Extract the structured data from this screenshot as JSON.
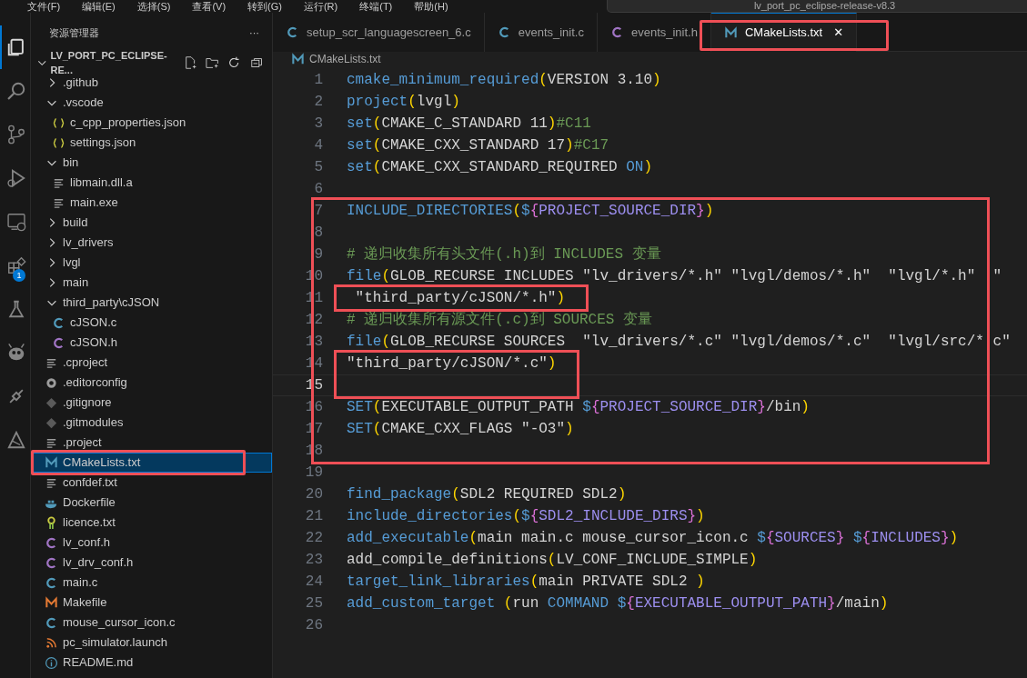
{
  "title_bar": {
    "menu": [
      "文件(F)",
      "编辑(E)",
      "选择(S)",
      "查看(V)",
      "转到(G)",
      "运行(R)",
      "终端(T)",
      "帮助(H)"
    ],
    "search": "lv_port_pc_eclipse-release-v8.3"
  },
  "activity_bar": [
    {
      "kind": "explorer",
      "selected": true
    },
    {
      "kind": "search",
      "selected": false
    },
    {
      "kind": "source-control",
      "selected": false
    },
    {
      "kind": "run",
      "selected": false
    },
    {
      "kind": "remote",
      "selected": false
    },
    {
      "kind": "extensions",
      "selected": false,
      "badge": "1"
    },
    {
      "kind": "testing",
      "selected": false
    },
    {
      "kind": "alien",
      "selected": false
    },
    {
      "kind": "plug",
      "selected": false
    },
    {
      "kind": "tool",
      "selected": false
    }
  ],
  "sidebar": {
    "title": "资源管理器",
    "more": "···",
    "root": {
      "label": "LV_PORT_PC_ECLIPSE-RE...",
      "expanded": true
    },
    "tree": [
      {
        "label": ".github",
        "kind": "folder",
        "expanded": false,
        "selected": false,
        "annotated": false
      },
      {
        "label": ".vscode",
        "kind": "folder",
        "expanded": true,
        "selected": false,
        "annotated": false,
        "children": [
          {
            "label": "c_cpp_properties.json",
            "kind": "json",
            "selected": false,
            "annotated": false
          },
          {
            "label": "settings.json",
            "kind": "json",
            "selected": false,
            "annotated": false
          }
        ]
      },
      {
        "label": "bin",
        "kind": "folder",
        "expanded": true,
        "selected": false,
        "annotated": false,
        "children": [
          {
            "label": "libmain.dll.a",
            "kind": "text",
            "selected": false,
            "annotated": false
          },
          {
            "label": "main.exe",
            "kind": "text",
            "selected": false,
            "annotated": false
          }
        ]
      },
      {
        "label": "build",
        "kind": "folder",
        "expanded": false,
        "selected": false,
        "annotated": false
      },
      {
        "label": "lv_drivers",
        "kind": "folder",
        "expanded": false,
        "selected": false,
        "annotated": false
      },
      {
        "label": "lvgl",
        "kind": "folder",
        "expanded": false,
        "selected": false,
        "annotated": false
      },
      {
        "label": "main",
        "kind": "folder",
        "expanded": false,
        "selected": false,
        "annotated": false
      },
      {
        "label": "third_party\\cJSON",
        "kind": "folder",
        "expanded": true,
        "selected": false,
        "annotated": false,
        "children": [
          {
            "label": "cJSON.c",
            "kind": "c",
            "selected": false,
            "annotated": false
          },
          {
            "label": "cJSON.h",
            "kind": "h",
            "selected": false,
            "annotated": false
          }
        ]
      },
      {
        "label": ".cproject",
        "kind": "text",
        "selected": false,
        "annotated": false
      },
      {
        "label": ".editorconfig",
        "kind": "gear",
        "selected": false,
        "annotated": false
      },
      {
        "label": ".gitignore",
        "kind": "git",
        "selected": false,
        "annotated": false
      },
      {
        "label": ".gitmodules",
        "kind": "git",
        "selected": false,
        "annotated": false
      },
      {
        "label": ".project",
        "kind": "text",
        "selected": false,
        "annotated": false
      },
      {
        "label": "CMakeLists.txt",
        "kind": "cmake",
        "selected": true,
        "annotated": true
      },
      {
        "label": "confdef.txt",
        "kind": "text",
        "selected": false,
        "annotated": false
      },
      {
        "label": "Dockerfile",
        "kind": "docker",
        "selected": false,
        "annotated": false
      },
      {
        "label": "licence.txt",
        "kind": "license",
        "selected": false,
        "annotated": false
      },
      {
        "label": "lv_conf.h",
        "kind": "h",
        "selected": false,
        "annotated": false
      },
      {
        "label": "lv_drv_conf.h",
        "kind": "h",
        "selected": false,
        "annotated": false
      },
      {
        "label": "main.c",
        "kind": "c",
        "selected": false,
        "annotated": false
      },
      {
        "label": "Makefile",
        "kind": "make",
        "selected": false,
        "annotated": false
      },
      {
        "label": "mouse_cursor_icon.c",
        "kind": "c",
        "selected": false,
        "annotated": false
      },
      {
        "label": "pc_simulator.launch",
        "kind": "rss",
        "selected": false,
        "annotated": false
      },
      {
        "label": "README.md",
        "kind": "info",
        "selected": false,
        "annotated": false
      }
    ]
  },
  "tabs": [
    {
      "label": "setup_scr_languagescreen_6.c",
      "kind": "c",
      "selected": false,
      "annotated": false
    },
    {
      "label": "events_init.c",
      "kind": "c",
      "selected": false,
      "annotated": false
    },
    {
      "label": "events_init.h",
      "kind": "h",
      "selected": false,
      "annotated": false
    },
    {
      "label": "CMakeLists.txt",
      "kind": "cmake",
      "selected": true,
      "annotated": true,
      "close": "✕"
    }
  ],
  "breadcrumb": {
    "label": "CMakeLists.txt",
    "kind": "cmake"
  },
  "code": [
    {
      "number": "1",
      "current": false,
      "in_block": false,
      "callout": false,
      "tokens": [
        {
          "kind": "keyword",
          "text": "cmake_minimum_required"
        },
        {
          "kind": "paren",
          "text": "("
        },
        {
          "kind": "plain",
          "text": "VERSION 3.10"
        },
        {
          "kind": "paren",
          "text": ")"
        }
      ]
    },
    {
      "number": "2",
      "current": false,
      "in_block": false,
      "callout": false,
      "tokens": [
        {
          "kind": "keyword",
          "text": "project"
        },
        {
          "kind": "paren",
          "text": "("
        },
        {
          "kind": "plain",
          "text": "lvgl"
        },
        {
          "kind": "paren",
          "text": ")"
        }
      ]
    },
    {
      "number": "3",
      "current": false,
      "in_block": false,
      "callout": false,
      "tokens": [
        {
          "kind": "keyword",
          "text": "set"
        },
        {
          "kind": "paren",
          "text": "("
        },
        {
          "kind": "plain",
          "text": "CMAKE_C_STANDARD 11"
        },
        {
          "kind": "paren",
          "text": ")"
        },
        {
          "kind": "comment",
          "text": "#C11"
        }
      ]
    },
    {
      "number": "4",
      "current": false,
      "in_block": false,
      "callout": false,
      "tokens": [
        {
          "kind": "keyword",
          "text": "set"
        },
        {
          "kind": "paren",
          "text": "("
        },
        {
          "kind": "plain",
          "text": "CMAKE_CXX_STANDARD 17"
        },
        {
          "kind": "paren",
          "text": ")"
        },
        {
          "kind": "comment",
          "text": "#C17"
        }
      ]
    },
    {
      "number": "5",
      "current": false,
      "in_block": false,
      "callout": false,
      "tokens": [
        {
          "kind": "keyword",
          "text": "set"
        },
        {
          "kind": "paren",
          "text": "("
        },
        {
          "kind": "plain",
          "text": "CMAKE_CXX_STANDARD_REQUIRED "
        },
        {
          "kind": "keyword",
          "text": "ON"
        },
        {
          "kind": "paren",
          "text": ")"
        }
      ]
    },
    {
      "number": "6",
      "current": false,
      "in_block": false,
      "callout": false
    },
    {
      "number": "7",
      "current": false,
      "in_block": true,
      "callout": false,
      "tokens": [
        {
          "kind": "keyword",
          "text": "INCLUDE_DIRECTORIES"
        },
        {
          "kind": "paren",
          "text": "("
        },
        {
          "kind": "keyword",
          "text": "$"
        },
        {
          "kind": "brace",
          "text": "{"
        },
        {
          "kind": "variable",
          "text": "PROJECT_SOURCE_DIR"
        },
        {
          "kind": "brace",
          "text": "}"
        },
        {
          "kind": "paren",
          "text": ")"
        }
      ]
    },
    {
      "number": "8",
      "current": false,
      "in_block": true,
      "callout": false
    },
    {
      "number": "9",
      "current": false,
      "in_block": true,
      "callout": false,
      "tokens": [
        {
          "kind": "comment",
          "text": "# 递归收集所有头文件(.h)到 INCLUDES 变量"
        }
      ]
    },
    {
      "number": "10",
      "current": false,
      "in_block": true,
      "callout": false,
      "tokens": [
        {
          "kind": "keyword",
          "text": "file"
        },
        {
          "kind": "paren",
          "text": "("
        },
        {
          "kind": "plain",
          "text": "GLOB_RECURSE INCLUDES \"lv_drivers/*.h\" \"lvgl/demos/*.h\"  \"lvgl/*.h\"  \""
        }
      ]
    },
    {
      "number": "11",
      "current": false,
      "in_block": true,
      "callout": true,
      "tokens": [
        {
          "kind": "plain",
          "text": " \"third_party/cJSON/*.h\""
        },
        {
          "kind": "paren",
          "text": ")"
        }
      ]
    },
    {
      "number": "12",
      "current": false,
      "in_block": true,
      "callout": false,
      "tokens": [
        {
          "kind": "comment",
          "text": "# 递归收集所有源文件(.c)到 SOURCES 变量"
        }
      ]
    },
    {
      "number": "13",
      "current": false,
      "in_block": true,
      "callout": false,
      "tokens": [
        {
          "kind": "keyword",
          "text": "file"
        },
        {
          "kind": "paren",
          "text": "("
        },
        {
          "kind": "plain",
          "text": "GLOB_RECURSE SOURCES  \"lv_drivers/*.c\" \"lvgl/demos/*.c\"  \"lvgl/src/*.c\""
        }
      ]
    },
    {
      "number": "14",
      "current": false,
      "in_block": true,
      "callout": true,
      "tokens": [
        {
          "kind": "plain",
          "text": "\"third_party/cJSON/*.c\""
        },
        {
          "kind": "paren",
          "text": ")"
        }
      ]
    },
    {
      "number": "15",
      "current": true,
      "in_block": true,
      "callout": true
    },
    {
      "number": "16",
      "current": false,
      "in_block": true,
      "callout": false,
      "tokens": [
        {
          "kind": "keyword",
          "text": "SET"
        },
        {
          "kind": "paren",
          "text": "("
        },
        {
          "kind": "plain",
          "text": "EXECUTABLE_OUTPUT_PATH "
        },
        {
          "kind": "keyword",
          "text": "$"
        },
        {
          "kind": "brace",
          "text": "{"
        },
        {
          "kind": "variable",
          "text": "PROJECT_SOURCE_DIR"
        },
        {
          "kind": "brace",
          "text": "}"
        },
        {
          "kind": "plain",
          "text": "/bin"
        },
        {
          "kind": "paren",
          "text": ")"
        }
      ]
    },
    {
      "number": "17",
      "current": false,
      "in_block": true,
      "callout": false,
      "tokens": [
        {
          "kind": "keyword",
          "text": "SET"
        },
        {
          "kind": "paren",
          "text": "("
        },
        {
          "kind": "plain",
          "text": "CMAKE_CXX_FLAGS \"-O3\""
        },
        {
          "kind": "paren",
          "text": ")"
        }
      ]
    },
    {
      "number": "18",
      "current": false,
      "in_block": true,
      "callout": false
    },
    {
      "number": "19",
      "current": false,
      "in_block": false,
      "callout": false
    },
    {
      "number": "20",
      "current": false,
      "in_block": false,
      "callout": false,
      "tokens": [
        {
          "kind": "keyword",
          "text": "find_package"
        },
        {
          "kind": "paren",
          "text": "("
        },
        {
          "kind": "plain",
          "text": "SDL2 REQUIRED SDL2"
        },
        {
          "kind": "paren",
          "text": ")"
        }
      ]
    },
    {
      "number": "21",
      "current": false,
      "in_block": false,
      "callout": false,
      "tokens": [
        {
          "kind": "keyword",
          "text": "include_directories"
        },
        {
          "kind": "paren",
          "text": "("
        },
        {
          "kind": "keyword",
          "text": "$"
        },
        {
          "kind": "brace",
          "text": "{"
        },
        {
          "kind": "variable",
          "text": "SDL2_INCLUDE_DIRS"
        },
        {
          "kind": "brace",
          "text": "}"
        },
        {
          "kind": "paren",
          "text": ")"
        }
      ]
    },
    {
      "number": "22",
      "current": false,
      "in_block": false,
      "callout": false,
      "tokens": [
        {
          "kind": "keyword",
          "text": "add_executable"
        },
        {
          "kind": "paren",
          "text": "("
        },
        {
          "kind": "plain",
          "text": "main main.c mouse_cursor_icon.c "
        },
        {
          "kind": "keyword",
          "text": "$"
        },
        {
          "kind": "brace",
          "text": "{"
        },
        {
          "kind": "variable",
          "text": "SOURCES"
        },
        {
          "kind": "brace",
          "text": "}"
        },
        {
          "kind": "keyword",
          "text": " $"
        },
        {
          "kind": "brace",
          "text": "{"
        },
        {
          "kind": "variable",
          "text": "INCLUDES"
        },
        {
          "kind": "brace",
          "text": "}"
        },
        {
          "kind": "paren",
          "text": ")"
        }
      ]
    },
    {
      "number": "23",
      "current": false,
      "in_block": false,
      "callout": false,
      "tokens": [
        {
          "kind": "plain",
          "text": "add_compile_definitions"
        },
        {
          "kind": "paren",
          "text": "("
        },
        {
          "kind": "plain",
          "text": "LV_CONF_INCLUDE_SIMPLE"
        },
        {
          "kind": "paren",
          "text": ")"
        }
      ]
    },
    {
      "number": "24",
      "current": false,
      "in_block": false,
      "callout": false,
      "tokens": [
        {
          "kind": "keyword",
          "text": "target_link_libraries"
        },
        {
          "kind": "paren",
          "text": "("
        },
        {
          "kind": "plain",
          "text": "main PRIVATE SDL2 "
        },
        {
          "kind": "paren",
          "text": ")"
        }
      ]
    },
    {
      "number": "25",
      "current": false,
      "in_block": false,
      "callout": false,
      "tokens": [
        {
          "kind": "keyword",
          "text": "add_custom_target "
        },
        {
          "kind": "paren",
          "text": "("
        },
        {
          "kind": "plain",
          "text": "run "
        },
        {
          "kind": "keyword",
          "text": "COMMAND "
        },
        {
          "kind": "keyword",
          "text": "$"
        },
        {
          "kind": "brace",
          "text": "{"
        },
        {
          "kind": "variable",
          "text": "EXECUTABLE_OUTPUT_PATH"
        },
        {
          "kind": "brace",
          "text": "}"
        },
        {
          "kind": "plain",
          "text": "/main"
        },
        {
          "kind": "paren",
          "text": ")"
        }
      ]
    },
    {
      "number": "26",
      "current": false,
      "in_block": false,
      "callout": false
    }
  ]
}
